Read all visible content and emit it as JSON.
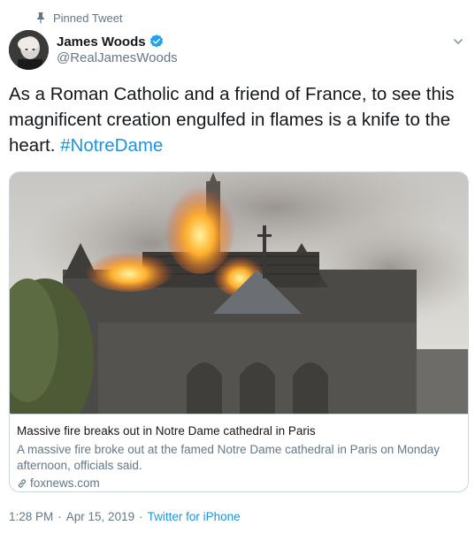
{
  "pinned": {
    "label": "Pinned Tweet",
    "icon": "pin-icon"
  },
  "author": {
    "name": "James Woods",
    "handle": "@RealJamesWoods",
    "verified_icon": "verified-badge-icon"
  },
  "tweet": {
    "text": "As a Roman Catholic and a friend of France, to see this magnificent creation engulfed in flames is a knife to the heart.",
    "hashtag": "#NotreDame"
  },
  "card": {
    "image_alt": "notre-dame-fire-photo",
    "title": "Massive fire breaks out in Notre Dame cathedral in Paris",
    "description": "A massive fire broke out at the famed Notre Dame cathedral in Paris on Monday afternoon, officials said.",
    "domain": "foxnews.com"
  },
  "meta": {
    "time": "1:28 PM",
    "date": "Apr 15, 2019",
    "separator": "·",
    "source": "Twitter for iPhone"
  },
  "colors": {
    "link": "#1b95e0",
    "secondary_text": "#657786",
    "border": "#ccd6dd",
    "text": "#14171a"
  }
}
